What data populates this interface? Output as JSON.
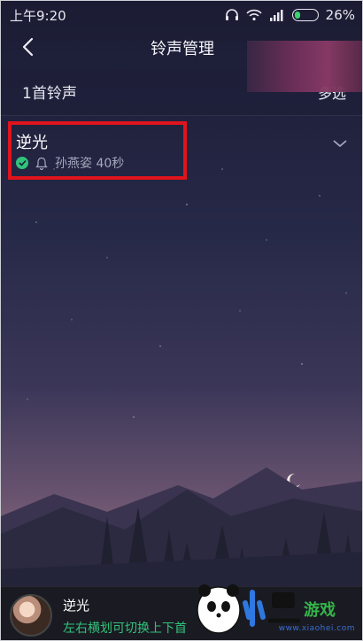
{
  "status_bar": {
    "time": "上午9:20",
    "battery": "26%",
    "battery_level": 0.26
  },
  "header": {
    "title": "铃声管理"
  },
  "list_header": {
    "count_label": "1首铃声",
    "multi_select_label": "多选"
  },
  "songs": [
    {
      "title": "逆光",
      "artist_duration": "孙燕姿 40秒"
    }
  ],
  "now_playing": {
    "title": "逆光",
    "hint": "左右横划可切换上下首"
  },
  "watermark": {
    "text": "www.xiaohei.com"
  },
  "colors": {
    "accent_green": "#31c27c",
    "highlight_red": "#e0141c"
  }
}
